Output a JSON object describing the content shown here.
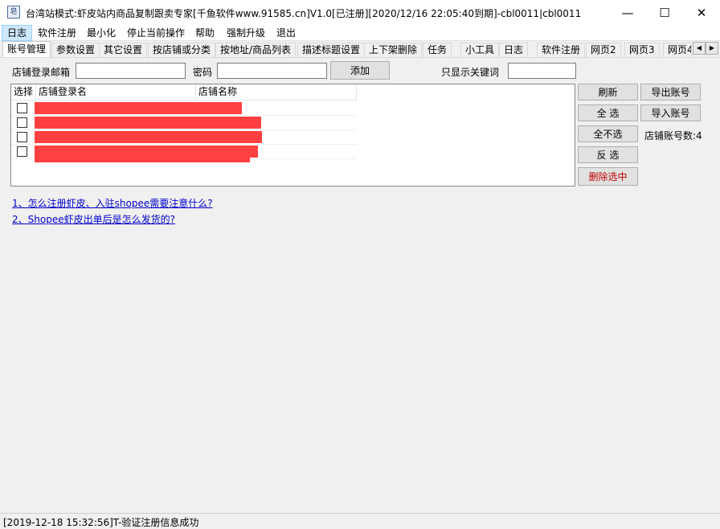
{
  "window": {
    "title": "台湾站模式:虾皮站内商品复制跟卖专家[千鱼软件www.91585.cn]V1.0[已注册][2020/12/16 22:05:40到期]-cbl0011|cbl0011",
    "icon_glyph": "皂",
    "minimize_glyph": "—",
    "maximize_glyph": "☐",
    "close_glyph": "✕"
  },
  "menu": [
    "日志",
    "软件注册",
    "最小化",
    "停止当前操作",
    "帮助",
    "强制升级",
    "退出"
  ],
  "tabs": [
    "账号管理",
    "参数设置",
    "其它设置",
    "按店铺或分类",
    "按地址/商品列表",
    "描述标题设置",
    "上下架删除",
    "任务",
    "小工具",
    "日志",
    "软件注册",
    "网页2",
    "网页3",
    "网页4"
  ],
  "tab_scroll": {
    "left": "◀",
    "right": "▶"
  },
  "form": {
    "email_label": "店铺登录邮箱",
    "email_value": "",
    "password_label": "密码",
    "password_value": "",
    "add_button": "添加",
    "keyword_label": "只显示关键词",
    "keyword_value": ""
  },
  "list": {
    "columns": [
      "选择",
      "店铺登录名",
      "店铺名称"
    ],
    "rows": [
      {
        "checked": false
      },
      {
        "checked": false
      },
      {
        "checked": false
      },
      {
        "checked": false
      }
    ]
  },
  "actions": {
    "refresh": "刷新",
    "export": "导出账号",
    "select_all": "全 选",
    "import": "导入账号",
    "select_none": "全不选",
    "count_label": "店铺账号数:",
    "count_value": "4",
    "invert": "反 选",
    "delete_selected": "删除选中"
  },
  "links": [
    "1、怎么注册虾皮、入驻shopee需要注意什么?",
    "2、Shopee虾皮出单后是怎么发货的?"
  ],
  "status": "[2019-12-18 15:32:56]T-验证注册信息成功",
  "colors": {
    "delete_text": "#c00000",
    "link": "#0000cc",
    "redaction": "#ff4040"
  }
}
